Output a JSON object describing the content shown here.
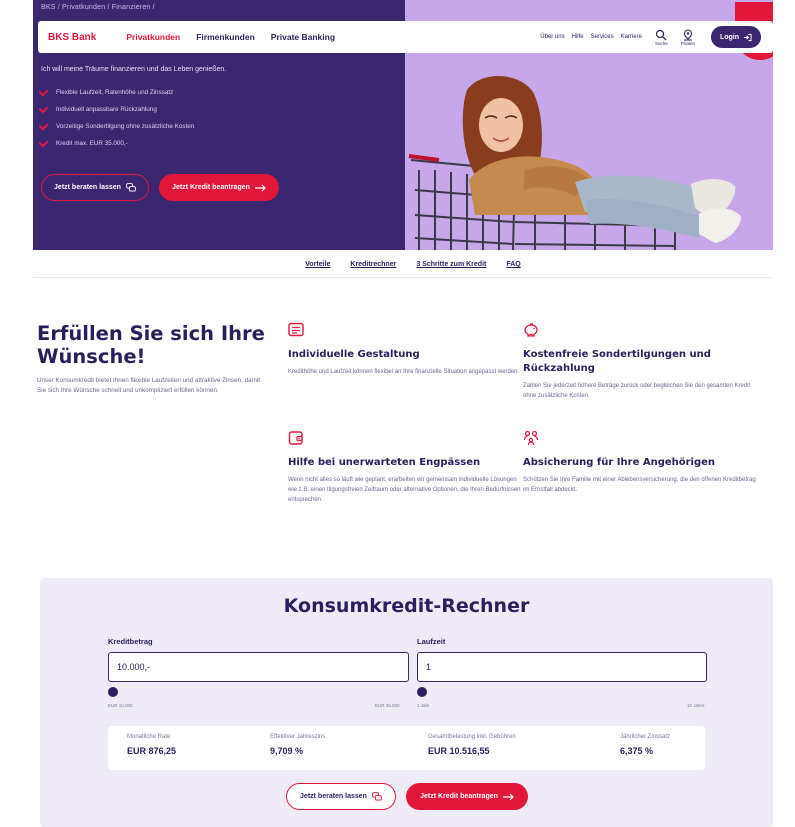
{
  "breadcrumb": "BKS / Privatkunden / Finanzieren /",
  "header": {
    "logo": "BKS Bank",
    "main_nav": [
      "Privatkunden",
      "Firmenkunden",
      "Private Banking"
    ],
    "sub_nav": [
      "Über uns",
      "Hilfe",
      "Services",
      "Karriere"
    ],
    "search_label": "Suche",
    "branches_label": "Filialen",
    "login_label": "Login"
  },
  "hero": {
    "intro": "Ich will meine Träume finanzieren und das Leben genießen.",
    "benefits": [
      "Flexible Laufzeit, Ratenhöhe und Zinssatz",
      "Individuell anpassbare Rückzahlung",
      "Vorzeitige Sondertilgung ohne zusätzliche Kosten",
      "Kredit max. EUR 35.000,-"
    ],
    "btn_consult": "Jetzt beraten lassen",
    "btn_apply": "Jetzt Kredit beantragen"
  },
  "anchors": [
    "Vorteile",
    "Kreditrechner",
    "3 Schritte zum Kredit",
    "FAQ"
  ],
  "features": {
    "title": "Erfüllen Sie sich Ihre Wünsche!",
    "description": "Unser Konsumkredit bietet Ihnen flexible Laufzeiten und attraktive Zinsen, damit Sie sich Ihre Wünsche schnell und unkompliziert erfüllen können.",
    "items": [
      {
        "title": "Individuelle Gestaltung",
        "text": "Kredithöhe und Laufzeit können flexibel an Ihre finanzielle Situation angepasst werden.",
        "icon": "document-list-icon"
      },
      {
        "title": "Kostenfreie Sondertilgungen und Rückzahlung",
        "text": "Zahlen Sie jederzeit höhere Beträge zurück oder begleichen Sie den gesamten Kredit ohne zusätzliche Kosten.",
        "icon": "piggy-bank-icon"
      },
      {
        "title": "Hilfe bei unerwarteten Engpässen",
        "text": "Wenn nicht alles so läuft wie geplant, erarbeiten wir gemeinsam individuelle Lösungen wie z.B. einen tilgungsfreien Zeitraum oder alternative Optionen, die Ihren Bedürfnissen entsprechen.",
        "icon": "wallet-icon"
      },
      {
        "title": "Absicherung für Ihre Angehörigen",
        "text": "Schützen Sie Ihre Familie mit einer Ablebensversicherung, die den offenen Kreditbetrag im Ernstfall abdeckt.",
        "icon": "family-icon"
      }
    ]
  },
  "calculator": {
    "title": "Konsumkredit-Rechner",
    "amount_label": "Kreditbetrag",
    "amount_value": "10.000,-",
    "amount_min": "EUR 10.000",
    "amount_max": "EUR 35.000",
    "amount_slider_fraction": 0,
    "term_label": "Laufzeit",
    "term_value": "1",
    "term_min": "1 Jahr",
    "term_max": "10 Jahre",
    "term_slider_fraction": 0,
    "results": [
      {
        "label": "Monatliche Rate",
        "value": "EUR 876,25"
      },
      {
        "label": "Effektiver Jahreszins",
        "value": "9,709 %"
      },
      {
        "label": "Gesamtbelastung inkl. Gebühren",
        "value": "EUR 10.516,55"
      },
      {
        "label": "Jährlicher Zinssatz",
        "value": "6,375 %"
      }
    ],
    "btn_consult": "Jetzt beraten lassen",
    "btn_apply": "Jetzt Kredit beantragen"
  },
  "colors": {
    "primary": "#3b2670",
    "accent": "#e0173a",
    "hero_photo_bg": "#c9a9ea",
    "calc_bg": "#eeebf6"
  }
}
